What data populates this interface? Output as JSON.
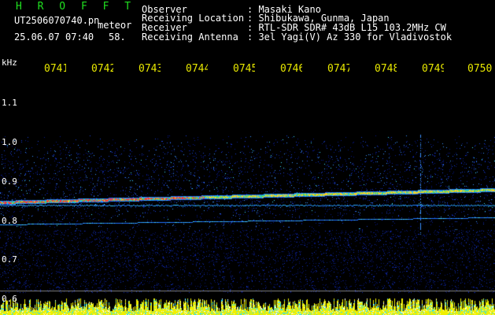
{
  "header": {
    "program_title": "H R O F F T",
    "filename": "UT2506070740.pn",
    "suffix": "meteor",
    "datetime": "25.06.07 07:40",
    "count": "58.",
    "fields": [
      {
        "label": "Observer",
        "value": ": Masaki Kano"
      },
      {
        "label": "Receiving Location",
        "value": ": Shibukawa, Gunma, Japan"
      },
      {
        "label": "Receiver",
        "value": ": RTL-SDR SDR# 43dB L15 103.2MHz CW"
      },
      {
        "label": "Receiving Antenna",
        "value": ": 3el Yagi(V) Az 330 for Vladivostok"
      }
    ]
  },
  "time_ticks": [
    "0741",
    "0742",
    "0743",
    "0744",
    "0745",
    "0746",
    "0747",
    "0748",
    "0749",
    "0750"
  ],
  "y_axis": {
    "unit": "kHz",
    "ticks": [
      "1.1",
      "1.0",
      "0.9",
      "0.8",
      "0.7",
      "0.6"
    ]
  },
  "colors": {
    "title": "#20e020",
    "ticks": "#e8e800",
    "text": "#ffffff",
    "signal": "#ff3030",
    "noise": "#1030c0"
  }
}
